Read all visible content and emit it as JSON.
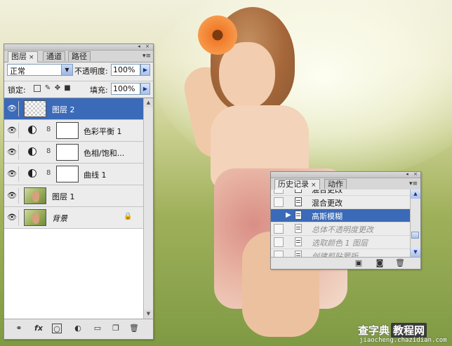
{
  "layers_panel": {
    "tabs": [
      {
        "label": "图层",
        "close": "×"
      },
      {
        "label": "通道"
      },
      {
        "label": "路径"
      }
    ],
    "blend_mode": "正常",
    "opacity_label": "不透明度:",
    "opacity_value": "100%",
    "lock_label": "锁定:",
    "fill_label": "填充:",
    "fill_value": "100%",
    "layers": [
      {
        "name": "图层 2"
      },
      {
        "name": "色彩平衡 1"
      },
      {
        "name": "色相/饱和..."
      },
      {
        "name": "曲线 1"
      },
      {
        "name": "图层 1"
      },
      {
        "name": "背景"
      }
    ],
    "bottom_icons": [
      "link-icon",
      "fx-icon",
      "mask-icon",
      "adjustment-icon",
      "folder-icon",
      "new-layer-icon",
      "trash-icon"
    ],
    "fx_label": "fx"
  },
  "history_panel": {
    "tabs": [
      {
        "label": "历史记录",
        "close": "×"
      },
      {
        "label": "动作"
      }
    ],
    "items": [
      {
        "text": "混合更改"
      },
      {
        "text": "混合更改"
      },
      {
        "text": "高斯模糊"
      },
      {
        "text": "总体不透明度更改"
      },
      {
        "text": "选取颜色 1 图层"
      },
      {
        "text": "创建剪贴蒙版"
      }
    ],
    "bottom_icons": [
      "new-document-icon",
      "snapshot-icon",
      "trash-icon"
    ]
  },
  "watermark": {
    "text1": "查字典",
    "text2": "教程网",
    "url": "jiaocheng.chazidian.com"
  }
}
